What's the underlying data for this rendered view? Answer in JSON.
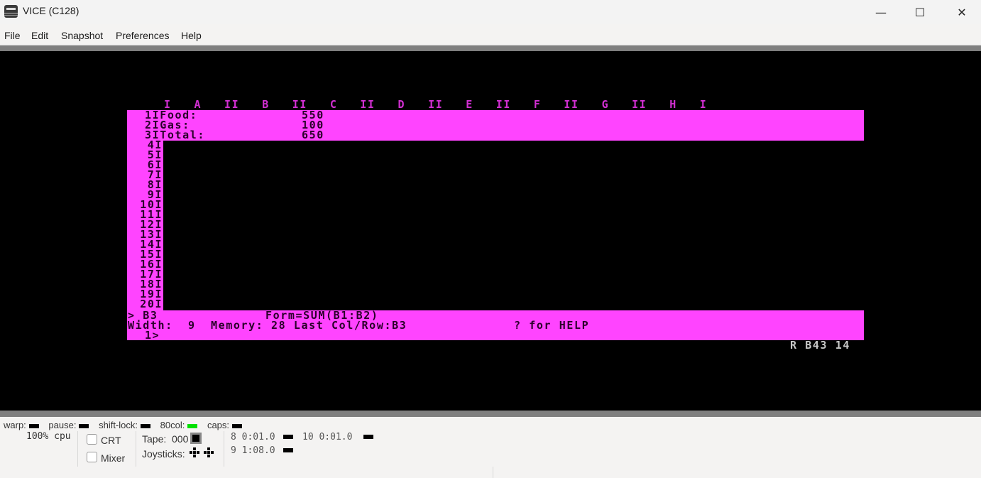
{
  "window": {
    "title": "VICE (C128)",
    "controls": {
      "minimize": "—",
      "maximize": "☐",
      "close": "✕"
    }
  },
  "menu": {
    "items": [
      "File",
      "Edit",
      "Snapshot",
      "Preferences",
      "Help"
    ]
  },
  "spreadsheet": {
    "column_header": "I   A   II   B   II   C   II   D   II   E   II   F   II   G   II   H   I",
    "columns": [
      "A",
      "B",
      "C",
      "D",
      "E",
      "F",
      "G",
      "H"
    ],
    "rows": [
      {
        "num": "1",
        "label": "Food:",
        "value": "550"
      },
      {
        "num": "2",
        "label": "Gas:",
        "value": "100"
      },
      {
        "num": "3",
        "label": "Total:",
        "value": "650"
      }
    ],
    "empty_row_numbers": [
      "4",
      "5",
      "6",
      "7",
      "8",
      "9",
      "10",
      "11",
      "12",
      "13",
      "14",
      "15",
      "16",
      "17",
      "18",
      "19",
      "20"
    ],
    "cursor_cell": "> B3",
    "formula": "Form=SUM(B1:B2)",
    "status_line": "Width:  9  Memory: 28 Last Col/Row:B3",
    "help_hint": "? for HELP",
    "prompt": "1>",
    "corner_status": "R B43 14",
    "colors": {
      "magenta": "#ff44ff",
      "screen": "#000000"
    }
  },
  "statusbar": {
    "indicators": [
      {
        "label": "warp:",
        "state": "off"
      },
      {
        "label": "pause:",
        "state": "off"
      },
      {
        "label": "shift-lock:",
        "state": "off"
      },
      {
        "label": "80col:",
        "state": "on",
        "color": "#00e000"
      },
      {
        "label": "caps:",
        "state": "off"
      }
    ],
    "cpu": "100% cpu",
    "crt_label": "CRT",
    "mixer_label": "Mixer",
    "tape_label": "Tape:",
    "tape_counter": "000",
    "joysticks_label": "Joysticks:",
    "drives": [
      {
        "text": "8 0:01.0"
      },
      {
        "text": "10 0:01.0"
      },
      {
        "text": "9 1:08.0"
      }
    ]
  }
}
